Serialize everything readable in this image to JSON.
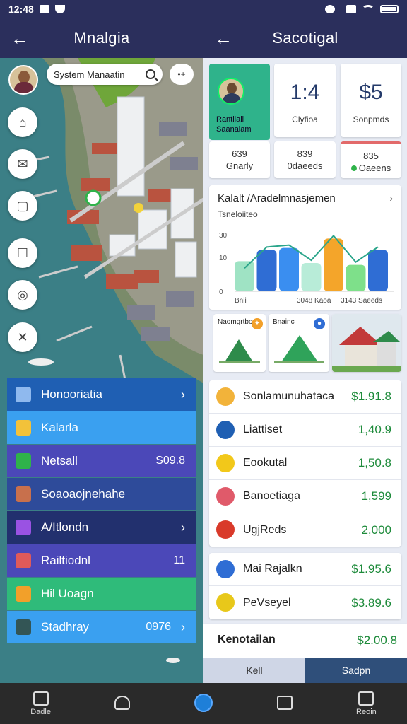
{
  "status": {
    "time": "12:48"
  },
  "left_header": {
    "title": "Mnalgia"
  },
  "right_header": {
    "title": "Sacotigal"
  },
  "map": {
    "search_text": "System Manaatin",
    "more_label": "•+",
    "side_buttons": [
      {
        "icon": "lock-icon",
        "glyph": "⌂"
      },
      {
        "icon": "message-icon",
        "glyph": "✉"
      },
      {
        "icon": "tag-icon",
        "glyph": "▢"
      },
      {
        "icon": "mail-icon",
        "glyph": "☐"
      },
      {
        "icon": "location-icon",
        "glyph": "◎"
      },
      {
        "icon": "close-icon",
        "glyph": "✕"
      }
    ]
  },
  "left_list": [
    {
      "label": "Honooriatia",
      "value": "",
      "chevron": true,
      "bg": "#1f5fb3",
      "icon_color": "#8fb9ee"
    },
    {
      "label": "Kalarla",
      "value": "",
      "chevron": false,
      "bg": "#3aa0f0",
      "icon_color": "#f2c23a"
    },
    {
      "label": "Netsall",
      "value": "S09.8",
      "chevron": false,
      "bg": "#4b48b8",
      "icon_color": "#2fb34a"
    },
    {
      "label": "Soaoaojnehahe",
      "value": "",
      "chevron": false,
      "bg": "#2e4b9a",
      "icon_color": "#c8704c"
    },
    {
      "label": "A/Itlondn",
      "value": "",
      "chevron": true,
      "bg": "#22306e",
      "icon_color": "#9a52e3"
    },
    {
      "label": "Railtiodnl",
      "value": "11",
      "chevron": false,
      "bg": "#4b48b8",
      "icon_color": "#e05a5a"
    },
    {
      "label": "Hil Uoagn",
      "value": "",
      "chevron": false,
      "bg": "#2fbb7a",
      "icon_color": "#f2a02a"
    },
    {
      "label": "Stadhray",
      "value": "0976",
      "chevron": true,
      "bg": "#3aa0f0",
      "icon_color": "#355"
    }
  ],
  "profile": {
    "name_line1": "Rantiiali",
    "name_line2": "Saanaiam"
  },
  "stats_big": [
    {
      "value": "1:4",
      "label": "Clyfioa"
    },
    {
      "value": "$5",
      "label": "Sonpmds"
    }
  ],
  "stats_small": [
    {
      "value": "639",
      "label": "Gnarly"
    },
    {
      "value": "839",
      "label": "0daeeds"
    },
    {
      "value": "835",
      "label": "Oaeens"
    }
  ],
  "chart_data": {
    "type": "bar",
    "title": "Kalalt /Aradelmnasjemen",
    "subtitle": "Tsneloiiteo",
    "categories": [
      "Bnii",
      "3048 Kaoa",
      "3143 Saeeds"
    ],
    "yticks": [
      "30",
      "10",
      "0"
    ],
    "values": [
      16,
      22,
      23,
      15,
      28,
      14,
      22
    ],
    "colors": [
      "#9fe3c4",
      "#2f6dd4",
      "#3a8ef0",
      "#b8ecd8",
      "#f4a52a",
      "#7ee08a",
      "#2f6dd4"
    ],
    "trend_color": "#2aa58a",
    "ylim": [
      0,
      30
    ]
  },
  "thumbs": [
    {
      "label": "Naomgrtbo",
      "badge_color": "#f2a02a",
      "badge": "✦"
    },
    {
      "label": "Bnainc",
      "badge_color": "#2f6dd4",
      "badge": "●"
    },
    {
      "label": "",
      "badge_color": "#2fb34a",
      "badge": "✦"
    }
  ],
  "transactions": [
    {
      "name": "Sonlamunuhataca",
      "amount": "$1.91.8",
      "icon_color": "#f2b33a"
    },
    {
      "name": "Liattiset",
      "amount": "1,40.9",
      "icon_color": "#1f5fb3"
    },
    {
      "name": "Eookutal",
      "amount": "1,50.8",
      "icon_color": "#f2c81a"
    },
    {
      "name": "Banoetiaga",
      "amount": "1,599",
      "icon_color": "#e05a6a"
    },
    {
      "name": "UgjReds",
      "amount": "2,000",
      "icon_color": "#d93a2a"
    }
  ],
  "transactions2": [
    {
      "name": "Mai Rajalkn",
      "amount": "$1.95.6",
      "icon_color": "#2f6dd4"
    },
    {
      "name": "PeVseyel",
      "amount": "$3.89.6",
      "icon_color": "#e8c81a"
    }
  ],
  "summary": {
    "label": "Kenotailan",
    "amount": "$2.00.8"
  },
  "tabs": [
    {
      "label": "Kell"
    },
    {
      "label": "Sadpn"
    }
  ],
  "bottom_nav": [
    {
      "label": "Dadle",
      "icon": "home-icon"
    },
    {
      "label": "",
      "icon": "heart-icon"
    },
    {
      "label": "",
      "icon": "center-button-icon"
    },
    {
      "label": "",
      "icon": "edit-icon"
    },
    {
      "label": "Reoin",
      "icon": "list-icon"
    }
  ]
}
